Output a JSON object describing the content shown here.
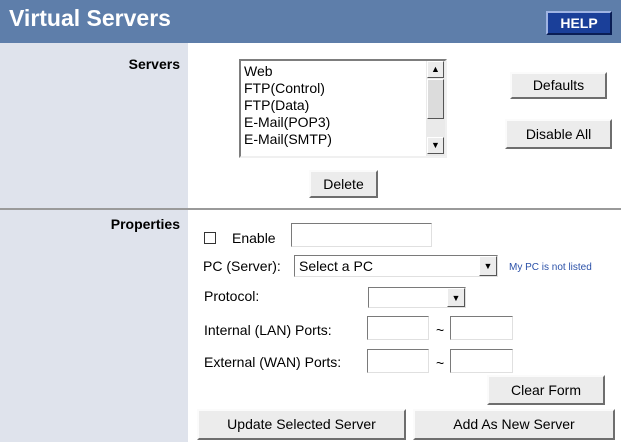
{
  "header": {
    "title": "Virtual Servers",
    "help_label": "HELP"
  },
  "servers": {
    "label": "Servers",
    "list_items": [
      "Web",
      "FTP(Control)",
      "FTP(Data)",
      "E-Mail(POP3)",
      "E-Mail(SMTP)"
    ],
    "defaults_label": "Defaults",
    "disable_all_label": "Disable All",
    "delete_label": "Delete"
  },
  "properties": {
    "label": "Properties",
    "enable_label": "Enable",
    "enable_value": "",
    "pc_label": "PC (Server):",
    "pc_selected": "Select a PC",
    "my_pc_link": "My PC is not listed",
    "protocol_label": "Protocol:",
    "protocol_selected": "",
    "internal_label": "Internal (LAN) Ports:",
    "external_label": "External (WAN) Ports:",
    "tilde": "~",
    "clear_form_label": "Clear Form",
    "update_label": "Update Selected Server",
    "add_new_label": "Add As New Server"
  },
  "colors": {
    "title_bar": "#5e7eaa",
    "help_button": "#1a3f99",
    "left_column": "#dfe3ec",
    "link": "#2a50a8"
  }
}
